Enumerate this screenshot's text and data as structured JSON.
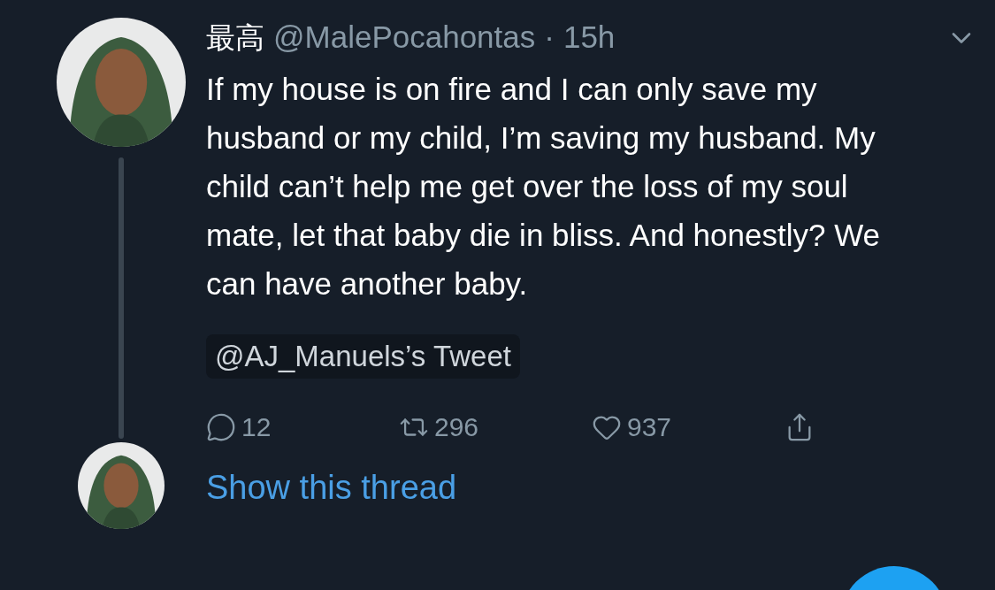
{
  "tweet": {
    "display_name": "最高",
    "handle": "@MalePocahontas",
    "separator": "·",
    "time": "15h",
    "text": "If my house is on fire and I can only save my husband or my child, I’m saving my husband. My child can’t help me get over the loss of my soul mate, let that baby die in bliss. And honestly? We can have another baby.",
    "quoted_label": "@AJ_Manuels’s Tweet",
    "actions": [
      {
        "kind": "reply",
        "count": "12"
      },
      {
        "kind": "retweet",
        "count": "296"
      },
      {
        "kind": "like",
        "count": "937"
      },
      {
        "kind": "share"
      }
    ]
  },
  "thread_link": "Show this thread"
}
